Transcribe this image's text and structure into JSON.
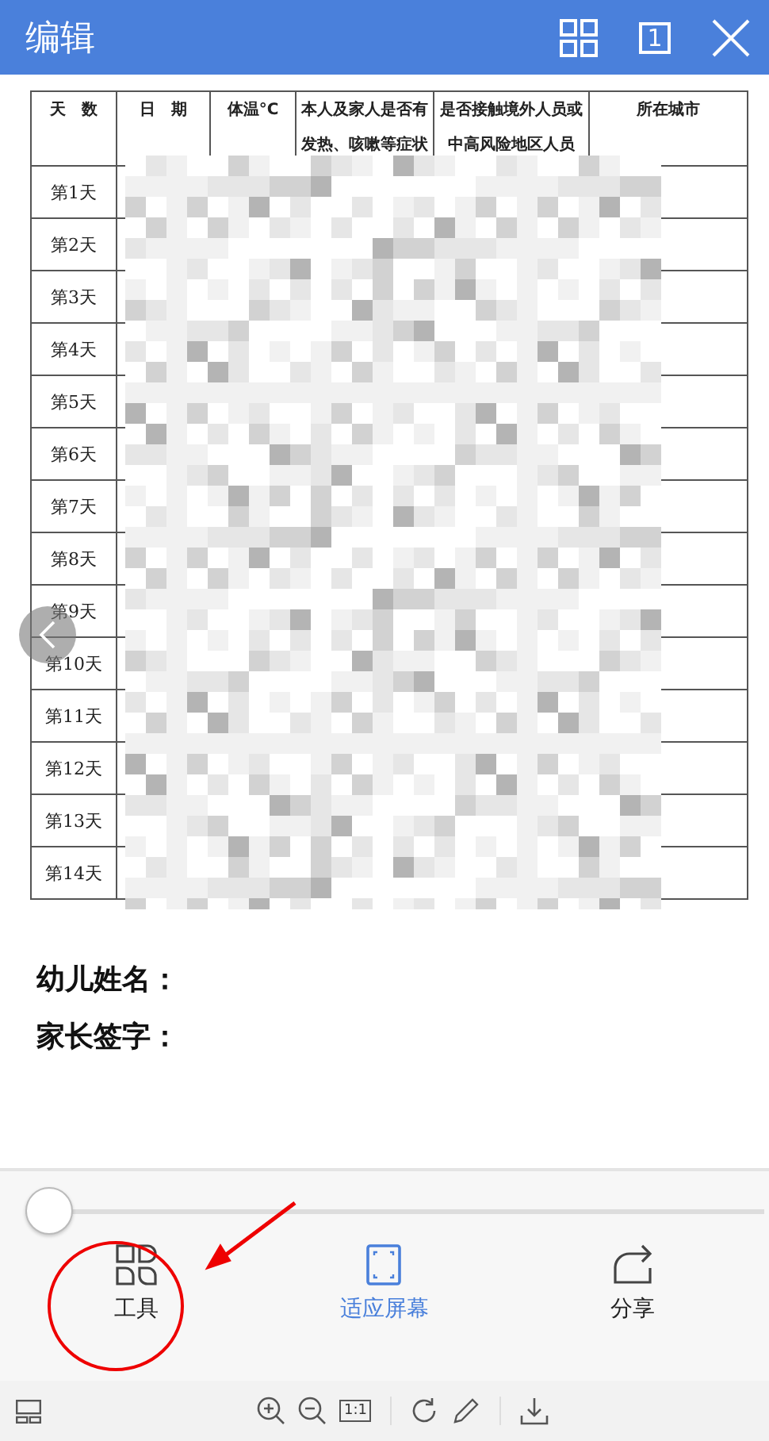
{
  "header": {
    "title": "编辑",
    "page_number": "1"
  },
  "table": {
    "columns": [
      {
        "lines": [
          "天　数"
        ]
      },
      {
        "lines": [
          "日　期"
        ]
      },
      {
        "lines": [
          "体温°C"
        ]
      },
      {
        "lines": [
          "本人及家人是否有",
          "发热、咳嗽等症状"
        ]
      },
      {
        "lines": [
          "是否接触境外人员或",
          "中高风险地区人员"
        ]
      },
      {
        "lines": [
          "所在城市"
        ]
      }
    ],
    "rows": [
      "第1天",
      "第2天",
      "第3天",
      "第4天",
      "第5天",
      "第6天",
      "第7天",
      "第8天",
      "第9天",
      "第10天",
      "第11天",
      "第12天",
      "第13天",
      "第14天"
    ]
  },
  "fields": [
    "幼儿姓名：",
    "家长签字："
  ],
  "slider": {
    "level": 0
  },
  "tools": [
    {
      "kind": "tools",
      "label": "工具",
      "selected": false
    },
    {
      "kind": "fit",
      "label": "适应屏幕",
      "selected": true
    },
    {
      "kind": "share",
      "label": "分享",
      "selected": false
    }
  ],
  "toolbar": {
    "actual_size": "1:1"
  }
}
